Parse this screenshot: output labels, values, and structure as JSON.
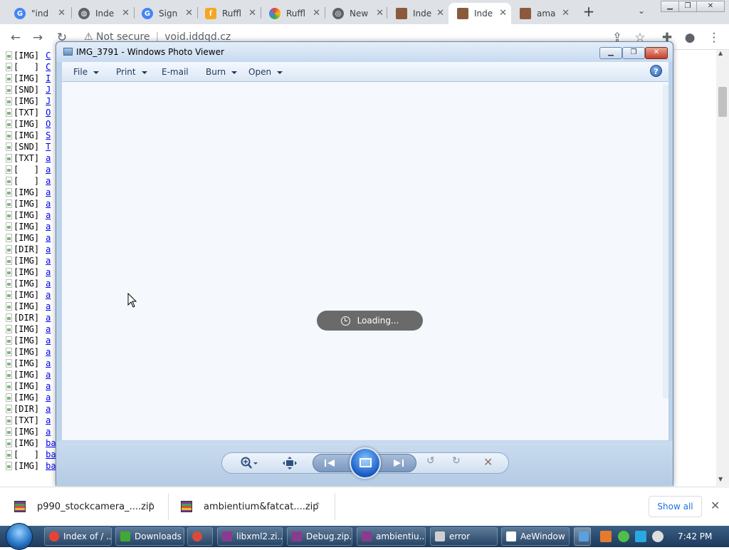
{
  "browser": {
    "tabs": [
      {
        "title": "\"ind",
        "icon": "google-icon"
      },
      {
        "title": "Inde",
        "icon": "globe-icon"
      },
      {
        "title": "Sign",
        "icon": "google-icon"
      },
      {
        "title": "Ruffl",
        "icon": "ruffle-icon"
      },
      {
        "title": "Ruffl",
        "icon": "rainbow-icon"
      },
      {
        "title": "New",
        "icon": "chrome-icon"
      },
      {
        "title": "Inde",
        "icon": "face-icon"
      },
      {
        "title": "Inde",
        "icon": "face-icon",
        "active": true
      },
      {
        "title": "ama",
        "icon": "face-icon"
      }
    ],
    "new_tab_symbol": "+",
    "address": {
      "security": "Not secure",
      "url": "void.iddqd.cz"
    }
  },
  "listing": {
    "rows": [
      {
        "tag": "[IMG]",
        "link": "C"
      },
      {
        "tag": "[   ]",
        "link": "C"
      },
      {
        "tag": "[IMG]",
        "link": "I"
      },
      {
        "tag": "[SND]",
        "link": "J"
      },
      {
        "tag": "[IMG]",
        "link": "J"
      },
      {
        "tag": "[TXT]",
        "link": "O"
      },
      {
        "tag": "[IMG]",
        "link": "O"
      },
      {
        "tag": "[IMG]",
        "link": "S"
      },
      {
        "tag": "[SND]",
        "link": "T"
      },
      {
        "tag": "[TXT]",
        "link": "a"
      },
      {
        "tag": "[   ]",
        "link": "a"
      },
      {
        "tag": "[   ]",
        "link": "a"
      },
      {
        "tag": "[IMG]",
        "link": "a"
      },
      {
        "tag": "[IMG]",
        "link": "a"
      },
      {
        "tag": "[IMG]",
        "link": "a"
      },
      {
        "tag": "[IMG]",
        "link": "a"
      },
      {
        "tag": "[IMG]",
        "link": "a"
      },
      {
        "tag": "[DIR]",
        "link": "a"
      },
      {
        "tag": "[IMG]",
        "link": "a"
      },
      {
        "tag": "[IMG]",
        "link": "a"
      },
      {
        "tag": "[IMG]",
        "link": "a"
      },
      {
        "tag": "[IMG]",
        "link": "a"
      },
      {
        "tag": "[IMG]",
        "link": "a"
      },
      {
        "tag": "[DIR]",
        "link": "a"
      },
      {
        "tag": "[IMG]",
        "link": "a"
      },
      {
        "tag": "[IMG]",
        "link": "a"
      },
      {
        "tag": "[IMG]",
        "link": "a"
      },
      {
        "tag": "[IMG]",
        "link": "a"
      },
      {
        "tag": "[IMG]",
        "link": "a"
      },
      {
        "tag": "[IMG]",
        "link": "a"
      },
      {
        "tag": "[IMG]",
        "link": "a"
      },
      {
        "tag": "[DIR]",
        "link": "a"
      },
      {
        "tag": "[TXT]",
        "link": "a"
      },
      {
        "tag": "[IMG]",
        "link": "a"
      },
      {
        "tag": "[IMG]",
        "link": "ba"
      },
      {
        "tag": "[   ]",
        "link": "ba"
      },
      {
        "tag": "[IMG]",
        "link": "ba"
      }
    ]
  },
  "photo_viewer": {
    "title": "IMG_3791 - Windows Photo Viewer",
    "menu": [
      {
        "label": "File",
        "has_caret": true
      },
      {
        "label": "Print",
        "has_caret": true
      },
      {
        "label": "E-mail",
        "has_caret": false
      },
      {
        "label": "Burn",
        "has_caret": true
      },
      {
        "label": "Open",
        "has_caret": true
      }
    ],
    "help_symbol": "?",
    "loading_text": "Loading...",
    "controls": [
      "zoom-icon",
      "fit-window-icon",
      "previous-icon",
      "slideshow-icon",
      "next-icon",
      "rotate-ccw-icon",
      "rotate-cw-icon",
      "delete-icon"
    ]
  },
  "downloads": {
    "items": [
      {
        "name": "p990_stockcamera_....zip"
      },
      {
        "name": "ambientium&fatcat....zip"
      }
    ],
    "show_all": "Show all"
  },
  "taskbar": {
    "items": [
      {
        "label": "Index of / ...",
        "icon": "chrome-icon",
        "color": "#e94235"
      },
      {
        "label": "Downloads",
        "icon": "download-icon",
        "color": "#3fa935"
      },
      {
        "label": "",
        "icon": "media-icon",
        "color": "#d94a3a"
      },
      {
        "label": "libxml2.zi...",
        "icon": "winrar-icon",
        "color": "#8a3b8f"
      },
      {
        "label": "Debug.zip...",
        "icon": "winrar-icon",
        "color": "#8a3b8f"
      },
      {
        "label": "ambientiu...",
        "icon": "winrar-icon",
        "color": "#8a3b8f"
      },
      {
        "label": "error",
        "icon": "console-icon",
        "color": "#cfcfcf"
      },
      {
        "label": "AeWindow",
        "icon": "window-icon",
        "color": "#ffffff"
      },
      {
        "label": "",
        "icon": "photo-viewer-icon",
        "color": "#5aa0e0"
      }
    ],
    "clock": "7:42 PM"
  }
}
